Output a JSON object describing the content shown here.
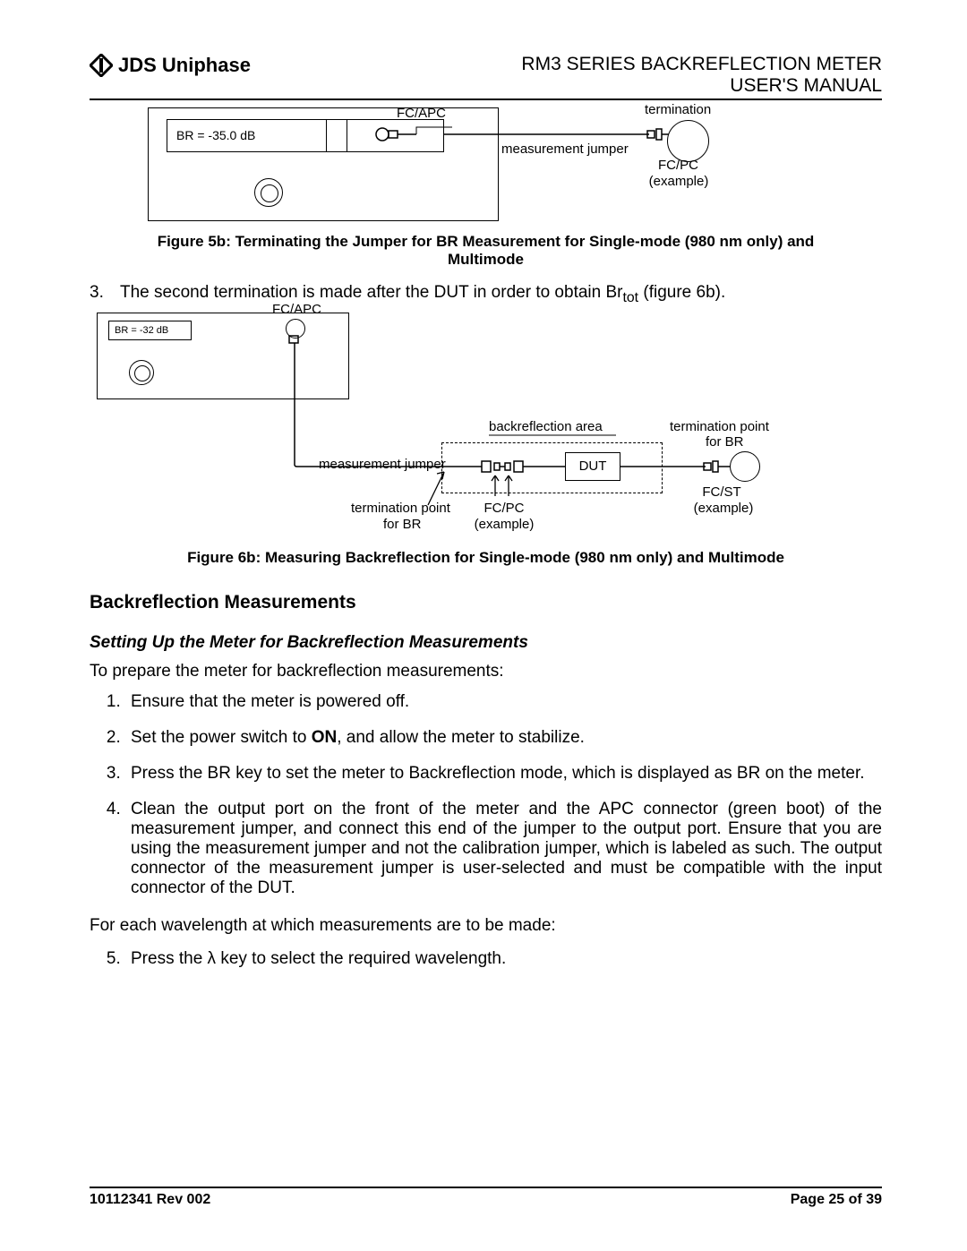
{
  "header": {
    "company": "JDS Uniphase",
    "title1": "RM3 SERIES BACKREFLECTION METER",
    "title2": "USER'S MANUAL"
  },
  "fig5": {
    "display": "BR = -35.0 dB",
    "port_label": "FC/APC",
    "termination": "termination",
    "mjumper": "measurement jumper",
    "fcpc": "FC/PC",
    "example": "(example)",
    "caption": "Figure 5b: Terminating the Jumper for BR Measurement for Single-mode (980 nm only) and Multimode"
  },
  "step3": {
    "num": "3.",
    "text_a": "The second termination is made after the DUT in order to obtain Br",
    "sub": "tot",
    "text_b": " (figure 6b)."
  },
  "fig6": {
    "display": "BR = -32 dB",
    "port_label": "FC/APC",
    "backarea": "backreflection area",
    "termpt": "termination point",
    "forBR": "for BR",
    "mjumper": "measurement jumper",
    "dut": "DUT",
    "fcst": "FC/ST",
    "example": "(example)",
    "fcpc": "FC/PC",
    "caption": "Figure 6b: Measuring Backreflection for Single-mode (980 nm only) and Multimode"
  },
  "section": {
    "h": "Backreflection Measurements",
    "sub": "Setting Up the Meter for Backreflection Measurements",
    "intro": "To prepare the meter for backreflection measurements:",
    "steps": [
      "Ensure that the meter is powered off.",
      "Set the power switch to ON, and allow the meter to stabilize.",
      "Press the BR key to set the meter to Backreflection mode, which is displayed as BR on the meter.",
      "Clean the output port on the front of the meter and the APC connector (green boot) of the measurement jumper, and connect this end of the jumper to the output port. Ensure that you are using the measurement jumper and not the calibration jumper, which is labeled as such. The output connector of the measurement jumper is user-selected and must be compatible with the input connector of the DUT."
    ],
    "mid": "For each wavelength at which measurements are to be made:",
    "step5": "Press the λ key to select the required wavelength."
  },
  "footer": {
    "left": "10112341 Rev 002",
    "right": "Page 25 of 39"
  }
}
